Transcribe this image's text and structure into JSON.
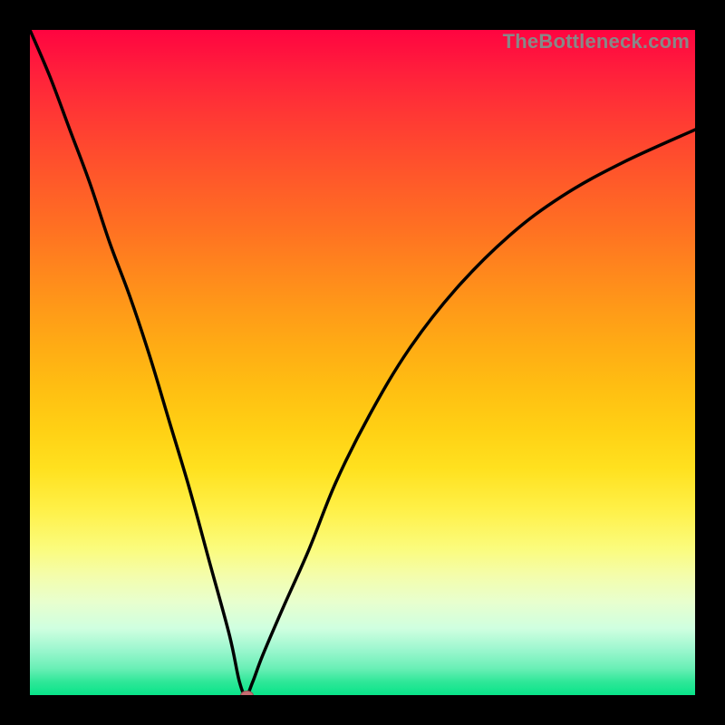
{
  "watermark": "TheBottleneck.com",
  "colors": {
    "frame": "#000000",
    "curve": "#000000",
    "marker": "#c86d72",
    "gradient_top": "#ff0440",
    "gradient_bottom": "#08e489"
  },
  "chart_data": {
    "type": "line",
    "title": "",
    "xlabel": "",
    "ylabel": "",
    "x_range": [
      0,
      1
    ],
    "y_range": [
      0,
      100
    ],
    "note": "V-shaped bottleneck curve. x is normalized component ratio, y is bottleneck percentage (higher = worse). Minimum near x≈0.32, y≈0.",
    "x": [
      0.0,
      0.03,
      0.06,
      0.09,
      0.12,
      0.15,
      0.18,
      0.21,
      0.24,
      0.27,
      0.3,
      0.315,
      0.325,
      0.335,
      0.35,
      0.38,
      0.42,
      0.46,
      0.51,
      0.57,
      0.64,
      0.72,
      0.8,
      0.89,
      1.0
    ],
    "y": [
      100,
      93,
      85,
      77,
      68,
      60,
      51,
      41,
      31,
      20,
      9,
      2,
      0,
      2,
      6,
      13,
      22,
      32,
      42,
      52,
      61,
      69,
      75,
      80,
      85
    ],
    "optimum_x": 0.325,
    "optimum_y": 0
  }
}
